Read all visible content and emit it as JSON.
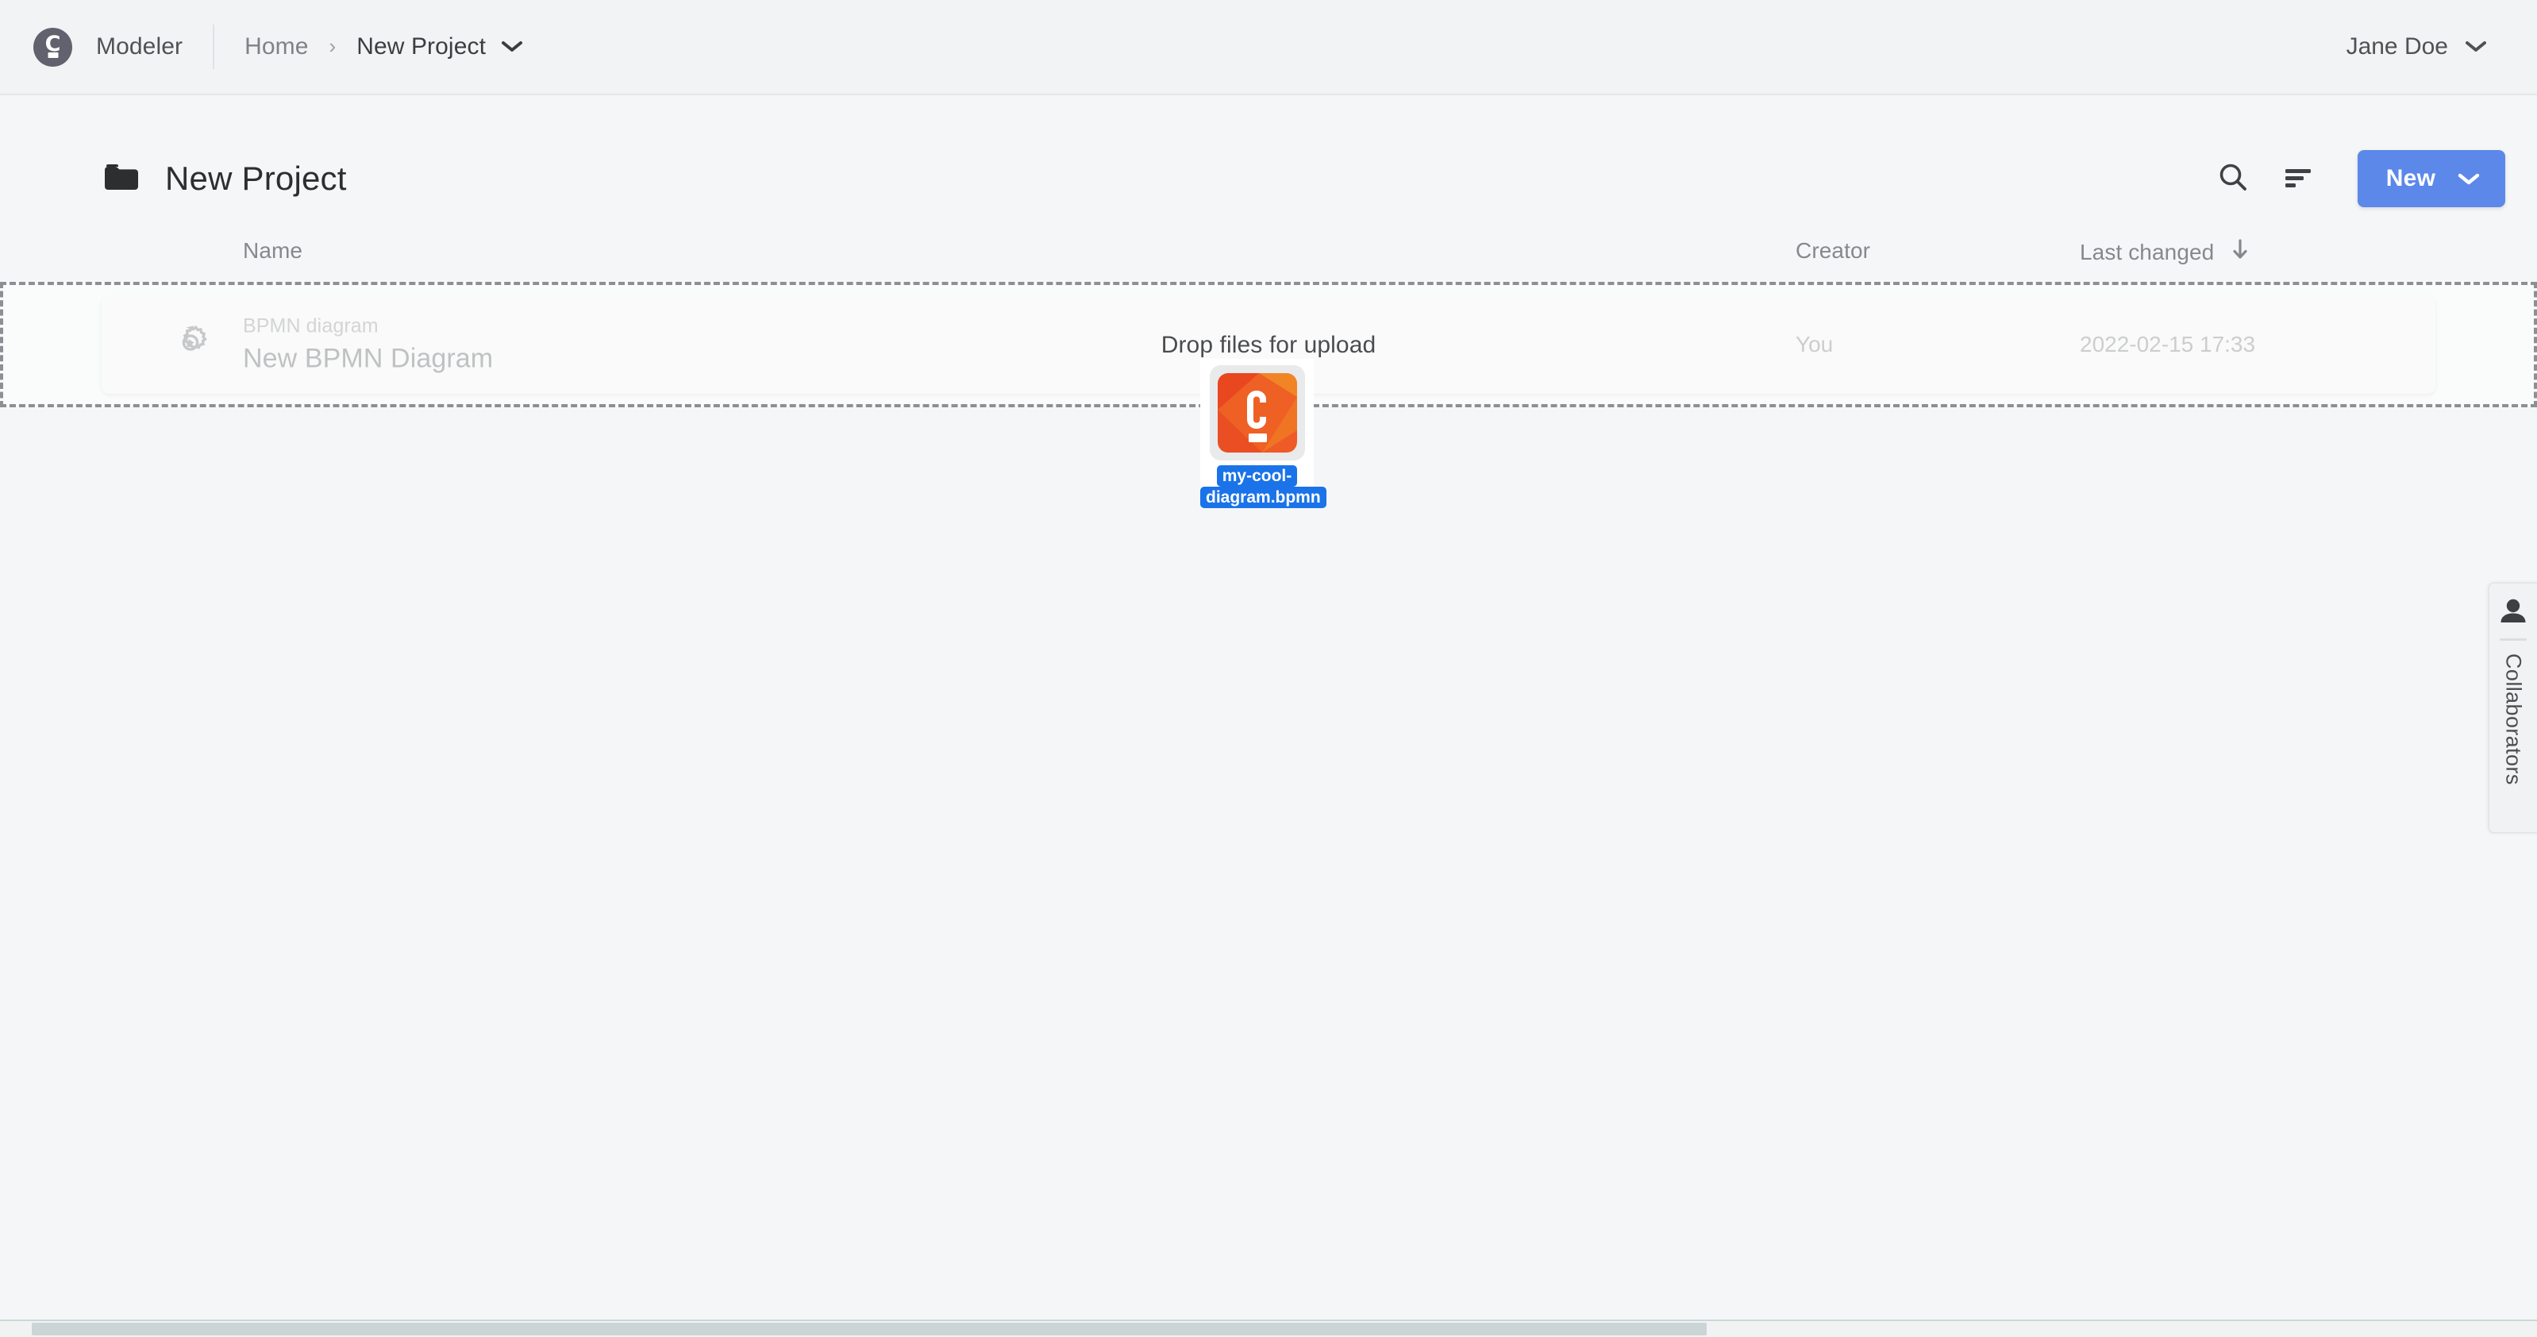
{
  "navbar": {
    "logo_icon": "camunda-logo-icon",
    "logo_letter": "C",
    "brand_name": "Modeler",
    "breadcrumb": {
      "home_label": "Home",
      "separator": "›",
      "current_label": "New Project",
      "caret_icon": "chevron-down-icon"
    },
    "user": {
      "name": "Jane Doe",
      "caret_icon": "chevron-down-icon"
    }
  },
  "page_header": {
    "folder_icon": "folder-icon",
    "title": "New Project",
    "actions": {
      "search_icon": "search-icon",
      "sort_icon": "sort-icon",
      "new_button_label": "New",
      "new_button_caret_icon": "chevron-down-icon",
      "new_button_color": "#5c88ea"
    }
  },
  "table": {
    "columns": [
      {
        "key": "name",
        "label": "Name"
      },
      {
        "key": "creator",
        "label": "Creator"
      },
      {
        "key": "last_changed",
        "label": "Last changed",
        "sort_icon": "arrow-down-icon",
        "sort_direction": "descending"
      }
    ],
    "rows": [
      {
        "icon": "bpmn-process-icon",
        "kind": "BPMN diagram",
        "name": "New BPMN Diagram",
        "creator": "You",
        "last_changed": "2022-02-15 17:33"
      }
    ]
  },
  "dropzone": {
    "active": true,
    "label": "Drop files for upload",
    "border_color": "#8c9094"
  },
  "drag_ghost": {
    "file_icon": "camunda-bpmn-file-icon",
    "icon_letter": "C",
    "filename": "my-cool-diagram.bpmn",
    "filename_line_1": "my-cool-",
    "filename_line_2": "diagram.bpmn",
    "highlight_color": "#1a73e8",
    "icon_color": "#ef5b26"
  },
  "collaborators_panel": {
    "icon": "person-icon",
    "label": "Collaborators"
  },
  "scrollbar": {
    "orientation": "horizontal",
    "thumb_color": "#ccd5d6"
  }
}
